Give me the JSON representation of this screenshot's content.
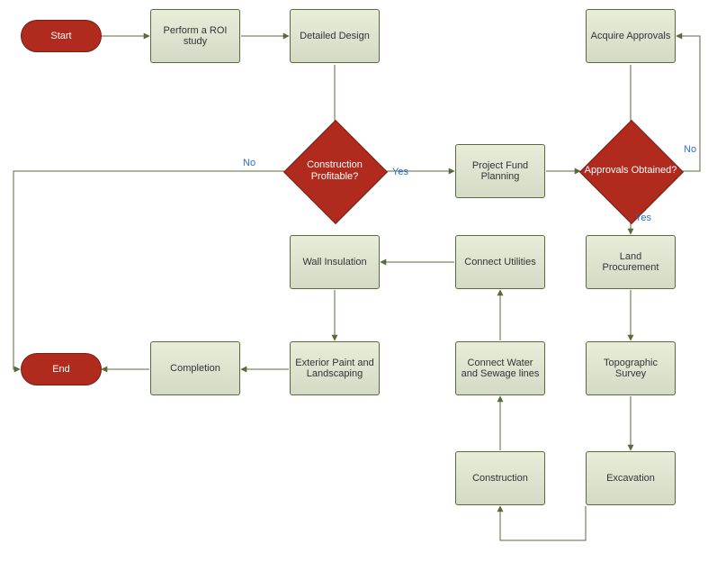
{
  "nodes": {
    "start": "Start",
    "roi": "Perform a ROI study",
    "design": "Detailed Design",
    "profitable": "Construction Profitable?",
    "funding": "Project Fund Planning",
    "approvals_obtained": "Approvals Obtained?",
    "acquire_approvals": "Acquire Approvals",
    "land": "Land Procurement",
    "survey": "Topographic Survey",
    "excavation": "Excavation",
    "construction": "Construction",
    "water": "Connect Water and Sewage lines",
    "utilities": "Connect Utilities",
    "insulation": "Wall Insulation",
    "paint": "Exterior Paint and Landscaping",
    "completion": "Completion",
    "end": "End"
  },
  "labels": {
    "yes": "Yes",
    "no": "No"
  },
  "chart_data": {
    "type": "flowchart",
    "title": "",
    "nodes": [
      {
        "id": "start",
        "type": "terminator",
        "label": "Start"
      },
      {
        "id": "roi",
        "type": "process",
        "label": "Perform a ROI study"
      },
      {
        "id": "design",
        "type": "process",
        "label": "Detailed Design"
      },
      {
        "id": "profitable",
        "type": "decision",
        "label": "Construction Profitable?"
      },
      {
        "id": "funding",
        "type": "process",
        "label": "Project Fund Planning"
      },
      {
        "id": "approvals_obtained",
        "type": "decision",
        "label": "Approvals Obtained?"
      },
      {
        "id": "acquire_approvals",
        "type": "process",
        "label": "Acquire Approvals"
      },
      {
        "id": "land",
        "type": "process",
        "label": "Land Procurement"
      },
      {
        "id": "survey",
        "type": "process",
        "label": "Topographic Survey"
      },
      {
        "id": "excavation",
        "type": "process",
        "label": "Excavation"
      },
      {
        "id": "construction",
        "type": "process",
        "label": "Construction"
      },
      {
        "id": "water",
        "type": "process",
        "label": "Connect Water and Sewage lines"
      },
      {
        "id": "utilities",
        "type": "process",
        "label": "Connect Utilities"
      },
      {
        "id": "insulation",
        "type": "process",
        "label": "Wall Insulation"
      },
      {
        "id": "paint",
        "type": "process",
        "label": "Exterior Paint and Landscaping"
      },
      {
        "id": "completion",
        "type": "process",
        "label": "Completion"
      },
      {
        "id": "end",
        "type": "terminator",
        "label": "End"
      }
    ],
    "edges": [
      {
        "from": "start",
        "to": "roi"
      },
      {
        "from": "roi",
        "to": "design"
      },
      {
        "from": "design",
        "to": "profitable"
      },
      {
        "from": "profitable",
        "to": "funding",
        "label": "Yes"
      },
      {
        "from": "profitable",
        "to": "end",
        "label": "No"
      },
      {
        "from": "funding",
        "to": "approvals_obtained"
      },
      {
        "from": "approvals_obtained",
        "to": "acquire_approvals",
        "label": "No"
      },
      {
        "from": "acquire_approvals",
        "to": "approvals_obtained"
      },
      {
        "from": "approvals_obtained",
        "to": "land",
        "label": "Yes"
      },
      {
        "from": "land",
        "to": "survey"
      },
      {
        "from": "survey",
        "to": "excavation"
      },
      {
        "from": "excavation",
        "to": "construction"
      },
      {
        "from": "construction",
        "to": "water"
      },
      {
        "from": "water",
        "to": "utilities"
      },
      {
        "from": "utilities",
        "to": "insulation"
      },
      {
        "from": "insulation",
        "to": "paint"
      },
      {
        "from": "paint",
        "to": "completion"
      },
      {
        "from": "completion",
        "to": "end"
      }
    ]
  }
}
